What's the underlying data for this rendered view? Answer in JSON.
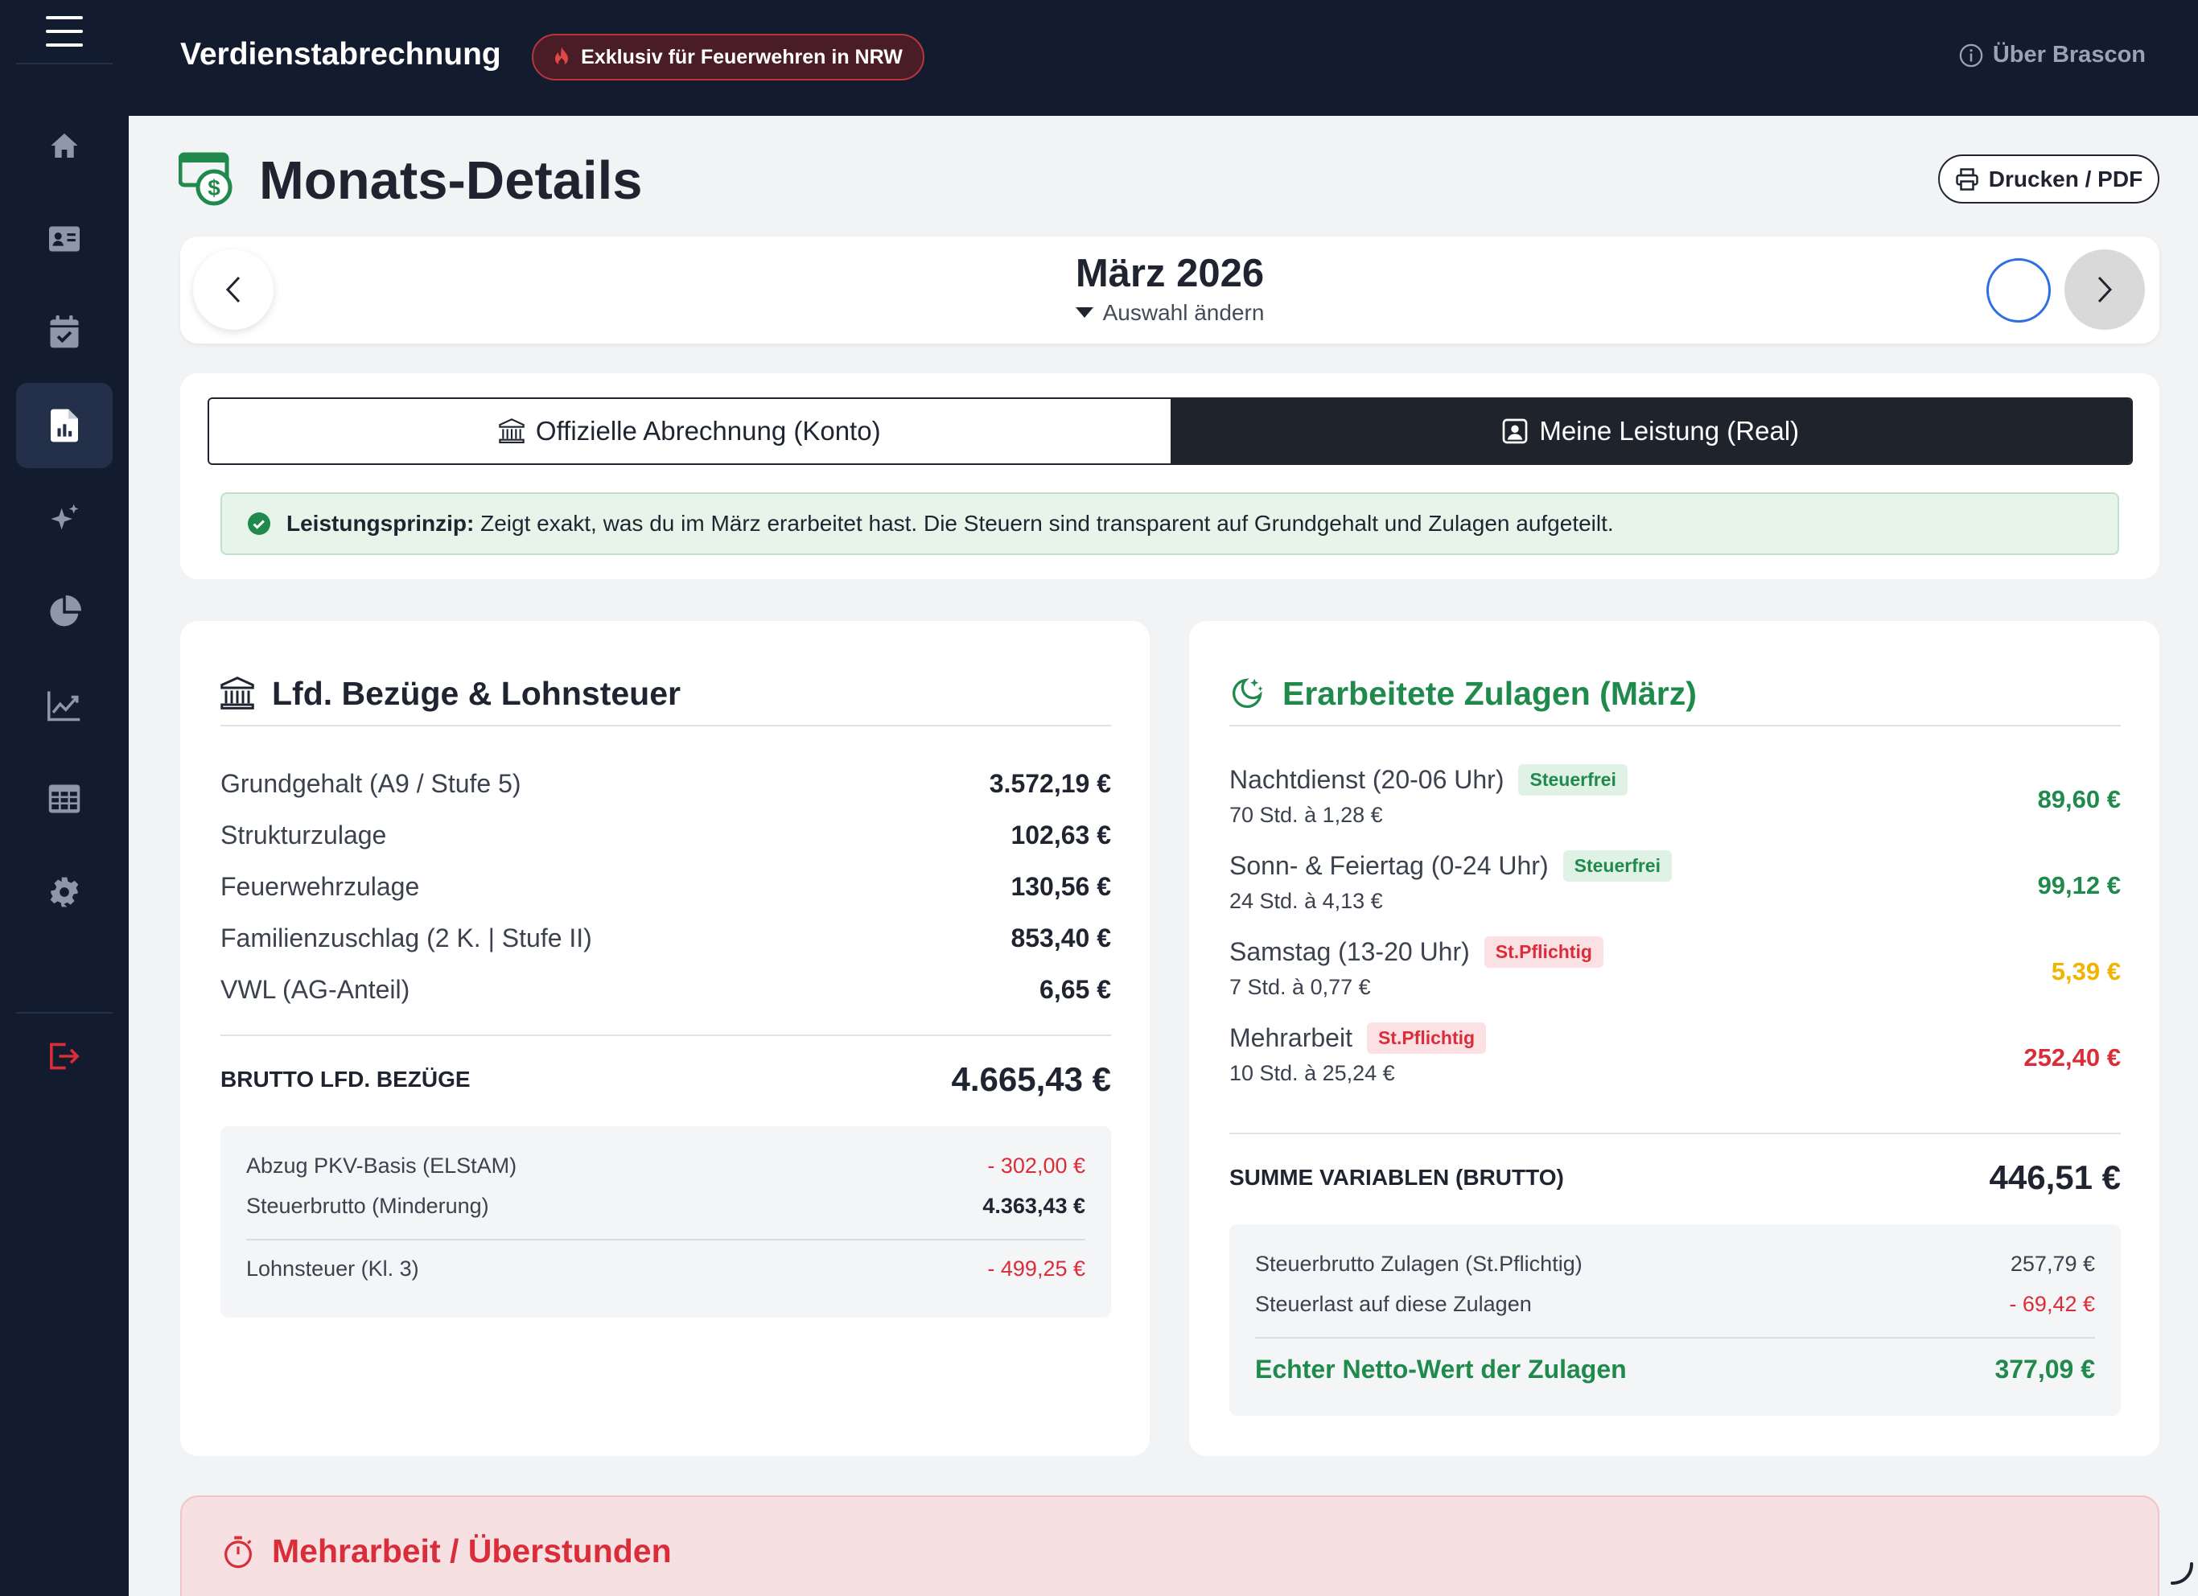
{
  "app": {
    "title": "Verdienstabrechnung",
    "badge": "Exklusiv für Feuerwehren in NRW",
    "about": "Über Brascon"
  },
  "sidebar": {
    "items": [
      {
        "icon": "home-icon"
      },
      {
        "icon": "id-card-icon"
      },
      {
        "icon": "calendar-check-icon"
      },
      {
        "icon": "document-chart-icon",
        "active": true
      },
      {
        "icon": "sparkles-icon"
      },
      {
        "icon": "pie-chart-icon"
      },
      {
        "icon": "trend-chart-icon"
      },
      {
        "icon": "table-icon"
      },
      {
        "icon": "gear-icon"
      },
      {
        "icon": "logout-icon"
      }
    ]
  },
  "page": {
    "title": "Monats-Details",
    "print_label": "Drucken / PDF"
  },
  "month": {
    "label": "März 2026",
    "change": "Auswahl ändern"
  },
  "mode": {
    "official": "Offizielle Abrechnung (Konto)",
    "real": "Meine Leistung (Real)",
    "selected": "real",
    "info_bold": "Leistungsprinzip:",
    "info_text": " Zeigt exakt, was du im März erarbeitet hast. Die Steuern sind transparent auf Grundgehalt und Zulagen aufgeteilt."
  },
  "salary": {
    "title": "Lfd. Bezüge & Lohnsteuer",
    "rows": [
      {
        "label": "Grundgehalt (A9 / Stufe 5)",
        "value": "3.572,19 €"
      },
      {
        "label": "Strukturzulage",
        "value": "102,63 €"
      },
      {
        "label": "Feuerwehrzulage",
        "value": "130,56 €"
      },
      {
        "label": "Familienzuschlag (2 K. | Stufe II)",
        "value": "853,40 €"
      },
      {
        "label": "VWL (AG-Anteil)",
        "value": "6,65 €"
      }
    ],
    "total_label": "BRUTTO LFD. BEZÜGE",
    "total_value": "4.665,43 €",
    "details": {
      "pkv_label": "Abzug PKV-Basis (ELStAM)",
      "pkv_value": "- 302,00 €",
      "brutto_label": "Steuerbrutto (Minderung)",
      "brutto_value": "4.363,43 €",
      "tax_label": "Lohnsteuer (Kl. 3)",
      "tax_value": "- 499,25 €"
    }
  },
  "bonus": {
    "title": "Erarbeitete Zulagen (März)",
    "items": [
      {
        "label": "Nachtdienst (20-06 Uhr)",
        "tag": "Steuerfrei",
        "tag_type": "free",
        "detail": "70 Std. à 1,28 €",
        "value": "89,60 €",
        "color": "#1f8a4c"
      },
      {
        "label": "Sonn- & Feiertag (0-24 Uhr)",
        "tag": "Steuerfrei",
        "tag_type": "free",
        "detail": "24 Std. à 4,13 €",
        "value": "99,12 €",
        "color": "#1f8a4c"
      },
      {
        "label": "Samstag (13-20 Uhr)",
        "tag": "St.Pflichtig",
        "tag_type": "tax",
        "detail": "7 Std. à 0,77 €",
        "value": "5,39 €",
        "color": "#f1b400"
      },
      {
        "label": "Mehrarbeit",
        "tag": "St.Pflichtig",
        "tag_type": "tax",
        "detail": "10 Std. à 25,24 €",
        "value": "252,40 €",
        "color": "#d92d3a"
      }
    ],
    "total_label": "SUMME VARIABLEN (BRUTTO)",
    "total_value": "446,51 €",
    "details": {
      "taxable_label": "Steuerbrutto Zulagen (St.Pflichtig)",
      "taxable_value": "257,79 €",
      "burden_label": "Steuerlast auf diese Zulagen",
      "burden_value": "- 69,42 €",
      "net_label": "Echter Netto-Wert der Zulagen",
      "net_value": "377,09 €"
    }
  },
  "overtime": {
    "title": "Mehrarbeit / Überstunden"
  }
}
